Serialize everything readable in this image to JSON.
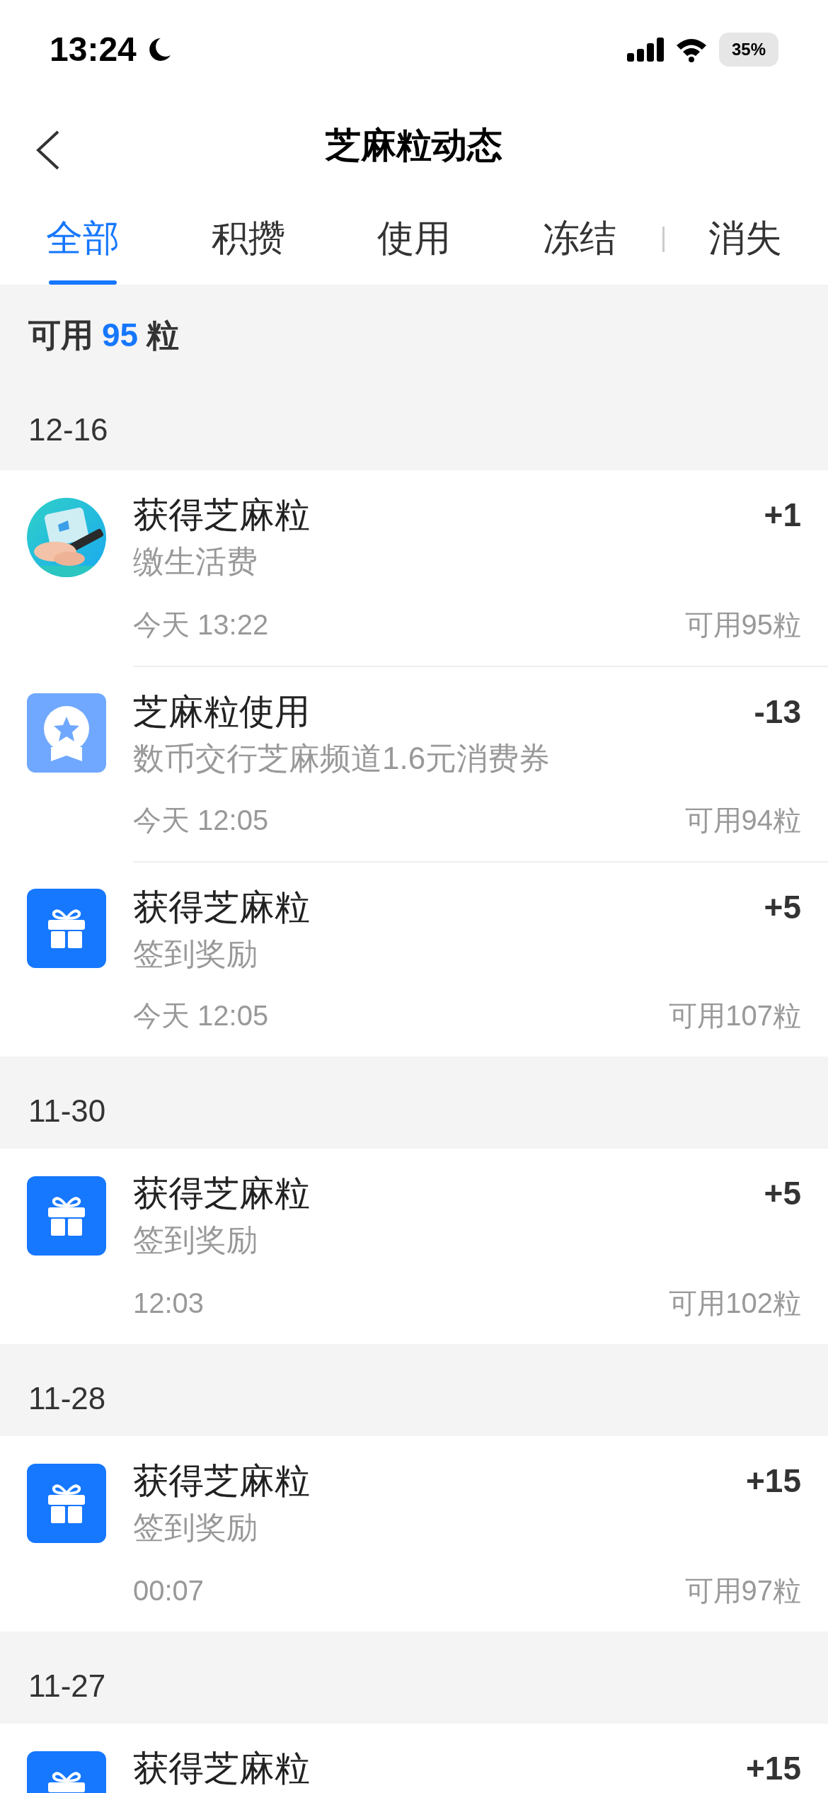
{
  "status_bar": {
    "time": "13:24",
    "battery": "35%"
  },
  "nav": {
    "title": "芝麻粒动态"
  },
  "tabs": [
    {
      "label": "全部",
      "selected": true
    },
    {
      "label": "积攒",
      "selected": false
    },
    {
      "label": "使用",
      "selected": false
    },
    {
      "label": "冻结",
      "selected": false
    },
    {
      "label": "消失",
      "selected": false
    }
  ],
  "summary": {
    "label": "可用",
    "count": "95",
    "unit": "粒"
  },
  "groups": [
    {
      "date": "12-16",
      "entries": [
        {
          "kind": "picture",
          "title": "获得芝麻粒",
          "subtitle": "缴生活费",
          "time": "今天 13:22",
          "amount": "+1",
          "balance": "可用95粒"
        },
        {
          "kind": "badge",
          "title": "芝麻粒使用",
          "subtitle": "数币交行芝麻频道1.6元消费券",
          "time": "今天 12:05",
          "amount": "-13",
          "balance": "可用94粒"
        },
        {
          "kind": "gift",
          "title": "获得芝麻粒",
          "subtitle": "签到奖励",
          "time": "今天 12:05",
          "amount": "+5",
          "balance": "可用107粒"
        }
      ]
    },
    {
      "date": "11-30",
      "entries": [
        {
          "kind": "gift",
          "title": "获得芝麻粒",
          "subtitle": "签到奖励",
          "time": "12:03",
          "amount": "+5",
          "balance": "可用102粒"
        }
      ]
    },
    {
      "date": "11-28",
      "entries": [
        {
          "kind": "gift",
          "title": "获得芝麻粒",
          "subtitle": "签到奖励",
          "time": "00:07",
          "amount": "+15",
          "balance": "可用97粒"
        }
      ]
    },
    {
      "date": "11-27",
      "entries": [
        {
          "kind": "gift",
          "title": "获得芝麻粒",
          "amount": "+15"
        }
      ]
    }
  ]
}
